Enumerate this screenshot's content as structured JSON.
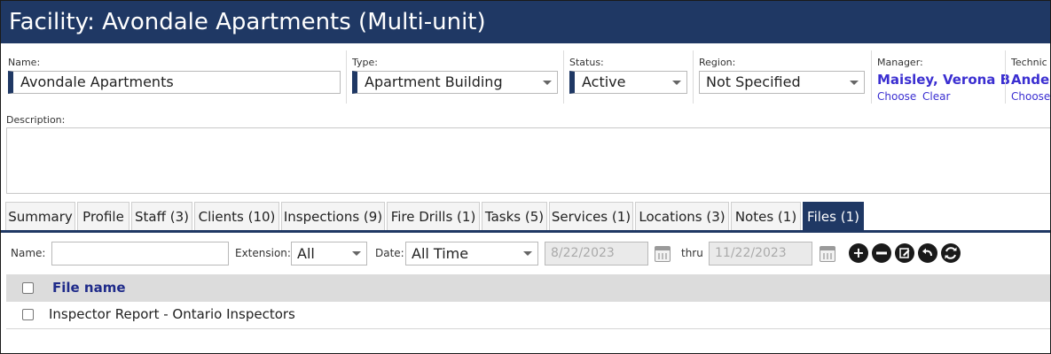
{
  "title": "Facility: Avondale Apartments (Multi-unit)",
  "fields": {
    "name": {
      "label": "Name:",
      "value": "Avondale Apartments"
    },
    "type": {
      "label": "Type:",
      "value": "Apartment Building"
    },
    "status": {
      "label": "Status:",
      "value": "Active"
    },
    "region": {
      "label": "Region:",
      "value": "Not Specified"
    },
    "manager": {
      "label": "Manager:",
      "value": "Maisley, Verona B",
      "choose": "Choose",
      "clear": "Clear"
    },
    "technician": {
      "label": "Technic",
      "value": "Ander",
      "choose": "Choose"
    },
    "description": {
      "label": "Description:",
      "value": ""
    }
  },
  "tabs": [
    {
      "label": "Summary",
      "active": false
    },
    {
      "label": "Profile",
      "active": false
    },
    {
      "label": "Staff (3)",
      "active": false
    },
    {
      "label": "Clients (10)",
      "active": false
    },
    {
      "label": "Inspections (9)",
      "active": false
    },
    {
      "label": "Fire Drills (1)",
      "active": false
    },
    {
      "label": "Tasks (5)",
      "active": false
    },
    {
      "label": "Services (1)",
      "active": false
    },
    {
      "label": "Locations (3)",
      "active": false
    },
    {
      "label": "Notes (1)",
      "active": false
    },
    {
      "label": "Files (1)",
      "active": true
    }
  ],
  "filters": {
    "name_label": "Name:",
    "name_value": "",
    "extension_label": "Extension:",
    "extension_value": "All",
    "date_label": "Date:",
    "date_value": "All Time",
    "from_date": "8/22/2023",
    "thru_label": "thru",
    "to_date": "11/22/2023"
  },
  "toolbar_icons": [
    "add-icon",
    "remove-icon",
    "edit-icon",
    "undo-icon",
    "refresh-icon"
  ],
  "table": {
    "column_header": "File name",
    "rows": [
      {
        "file_name": "Inspector Report - Ontario Inspectors",
        "checked": false
      }
    ]
  },
  "colors": {
    "header_bg": "#1f3864",
    "link": "#3b2fd1",
    "table_header_bg": "#dcdcdc"
  }
}
